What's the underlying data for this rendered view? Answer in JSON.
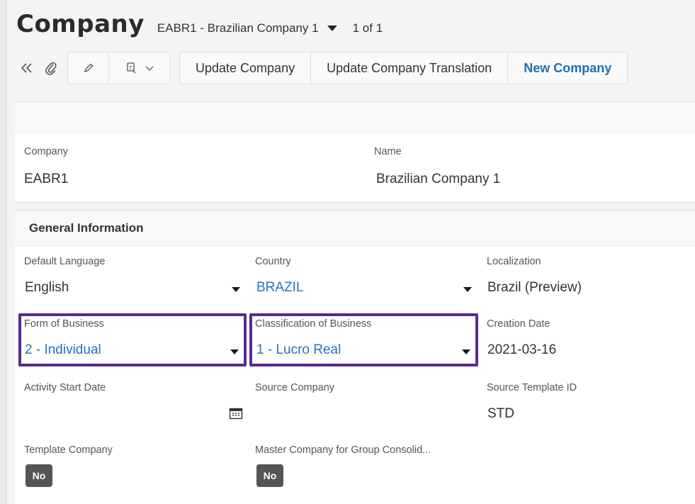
{
  "header": {
    "title": "Company",
    "record_selector": "EABR1 - Brazilian Company 1",
    "record_count": "1 of 1"
  },
  "toolbar": {
    "icons": [
      "double-chevron-left-icon",
      "paperclip-icon",
      "pencil-icon",
      "custom-object-icon",
      "chevron-down-icon"
    ],
    "commands": [
      "Update Company",
      "Update Company Translation",
      "New Company"
    ]
  },
  "summary": {
    "company_label": "Company",
    "company_value": "EABR1",
    "name_label": "Name",
    "name_value": "Brazilian Company 1"
  },
  "general": {
    "section_title": "General Information",
    "default_language_label": "Default Language",
    "default_language_value": "English",
    "country_label": "Country",
    "country_value": "BRAZIL",
    "localization_label": "Localization",
    "localization_value": "Brazil (Preview)",
    "form_of_business_label": "Form of Business",
    "form_of_business_value": "2 - Individual",
    "classification_label": "Classification of Business",
    "classification_value": "1 - Lucro Real",
    "creation_date_label": "Creation Date",
    "creation_date_value": "2021-03-16",
    "activity_start_label": "Activity Start Date",
    "activity_start_value": "",
    "source_company_label": "Source Company",
    "source_company_value": "",
    "source_template_label": "Source Template ID",
    "source_template_value": "STD",
    "template_company_label": "Template Company",
    "template_company_value": "No",
    "master_company_label": "Master Company for Group Consolid...",
    "master_company_value": "No"
  },
  "colors": {
    "highlight": "#5a2a8f",
    "link": "#2474b5",
    "badge": "#555555"
  }
}
